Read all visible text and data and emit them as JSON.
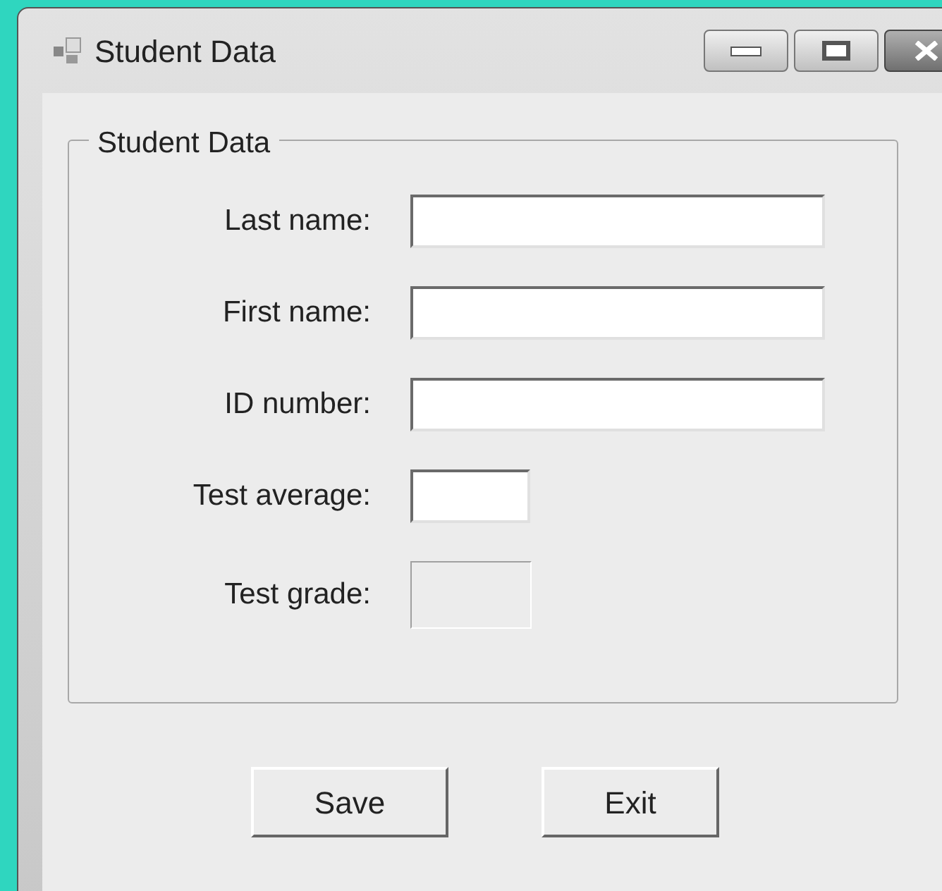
{
  "window": {
    "title": "Student Data"
  },
  "group": {
    "title": "Student Data",
    "fields": [
      {
        "label": "Last name:",
        "kind": "text"
      },
      {
        "label": "First name:",
        "kind": "text"
      },
      {
        "label": "ID number:",
        "kind": "text"
      },
      {
        "label": "Test average:",
        "kind": "short"
      },
      {
        "label": "Test grade:",
        "kind": "display"
      }
    ]
  },
  "buttons": [
    "Save",
    "Exit"
  ]
}
